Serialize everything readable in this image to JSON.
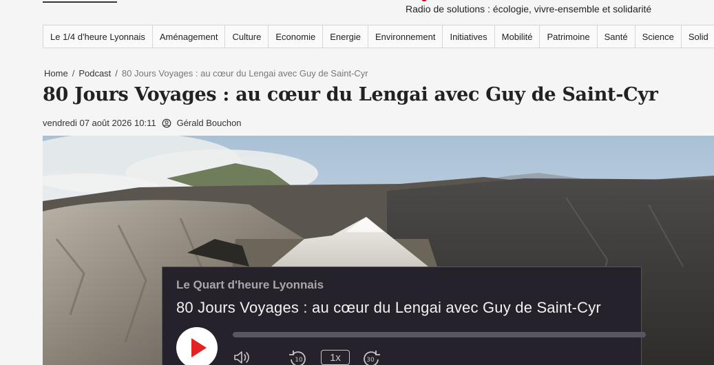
{
  "header": {
    "tagline": "Radio de solutions : écologie, vivre-ensemble et solidarité"
  },
  "nav": {
    "items": [
      "Le 1/4 d'heure Lyonnais",
      "Aménagement",
      "Culture",
      "Economie",
      "Energie",
      "Environnement",
      "Initiatives",
      "Mobilité",
      "Patrimoine",
      "Santé",
      "Science",
      "Solid"
    ]
  },
  "breadcrumb": {
    "home": "Home",
    "section": "Podcast",
    "current": "80 Jours Voyages : au cœur du Lengai avec Guy de Saint-Cyr"
  },
  "article": {
    "title": "80 Jours Voyages : au cœur du Lengai avec Guy de Saint-Cyr",
    "date": "vendredi 07 août 2026 10:11",
    "author": "Gérald Bouchon"
  },
  "player": {
    "show": "Le Quart d'heure Lyonnais",
    "episode": "80 Jours Voyages : au cœur du Lengai avec Guy de Saint-Cyr",
    "speed": "1x",
    "rewind_seconds": "10",
    "forward_seconds": "30",
    "progress": 0
  },
  "icons": {
    "author": "user-circle-icon",
    "play": "play-icon",
    "volume": "volume-icon",
    "rewind": "rewind-10-icon",
    "forward": "forward-30-icon"
  },
  "colors": {
    "play_accent": "#e02424",
    "player_bg": "#26222b"
  }
}
